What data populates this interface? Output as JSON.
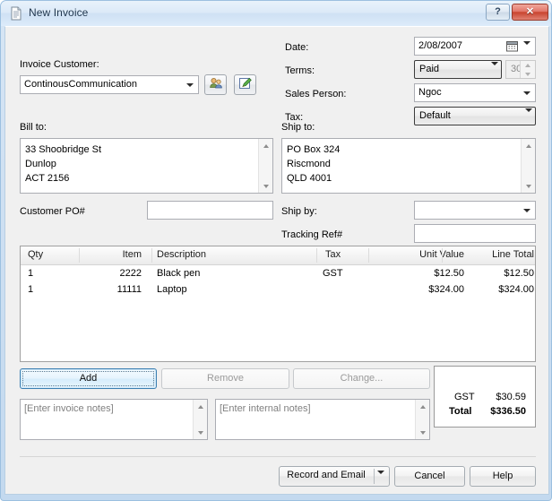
{
  "window": {
    "title": "New Invoice",
    "icon": "document-icon",
    "help_button": "?",
    "close_button": "✕"
  },
  "customer": {
    "label": "Invoice Customer:",
    "value": "ContinousCommunication",
    "select_customer_icon": "users-icon",
    "edit_customer_icon": "edit-pencil-icon"
  },
  "header_fields": {
    "date_label": "Date:",
    "date_value": "2/08/2007",
    "terms_label": "Terms:",
    "terms_value": "Paid",
    "terms_days": "30",
    "sales_person_label": "Sales Person:",
    "sales_person_value": "Ngoc",
    "tax_label": "Tax:",
    "tax_value": "Default"
  },
  "bill_to": {
    "label": "Bill to:",
    "address": "33 Shoobridge St\nDunlop\nACT 2156"
  },
  "ship_to": {
    "label": "Ship to:",
    "address": "PO Box 324\nRiscmond\nQLD 4001"
  },
  "customer_po": {
    "label": "Customer PO#",
    "value": ""
  },
  "ship_by": {
    "label": "Ship by:",
    "value": ""
  },
  "tracking_ref": {
    "label": "Tracking Ref#",
    "value": ""
  },
  "line_items": {
    "columns": [
      "Qty",
      "Item",
      "Description",
      "Tax",
      "Unit Value",
      "Line Total"
    ],
    "rows": [
      {
        "qty": "1",
        "item": "2222",
        "description": "Black pen",
        "tax": "GST",
        "unit_value": "$12.50",
        "line_total": "$12.50"
      },
      {
        "qty": "1",
        "item": "11111",
        "description": "Laptop",
        "tax": "",
        "unit_value": "$324.00",
        "line_total": "$324.00"
      }
    ]
  },
  "grid_buttons": {
    "add": "Add",
    "remove": "Remove",
    "change": "Change..."
  },
  "totals": {
    "gst_label": "GST",
    "gst_value": "$30.59",
    "total_label": "Total",
    "total_value": "$336.50"
  },
  "notes": {
    "invoice_placeholder": "[Enter invoice notes]",
    "invoice_value": "",
    "internal_placeholder": "[Enter internal notes]",
    "internal_value": ""
  },
  "footer_buttons": {
    "record_and_email": "Record and Email",
    "cancel": "Cancel",
    "help": "Help"
  }
}
